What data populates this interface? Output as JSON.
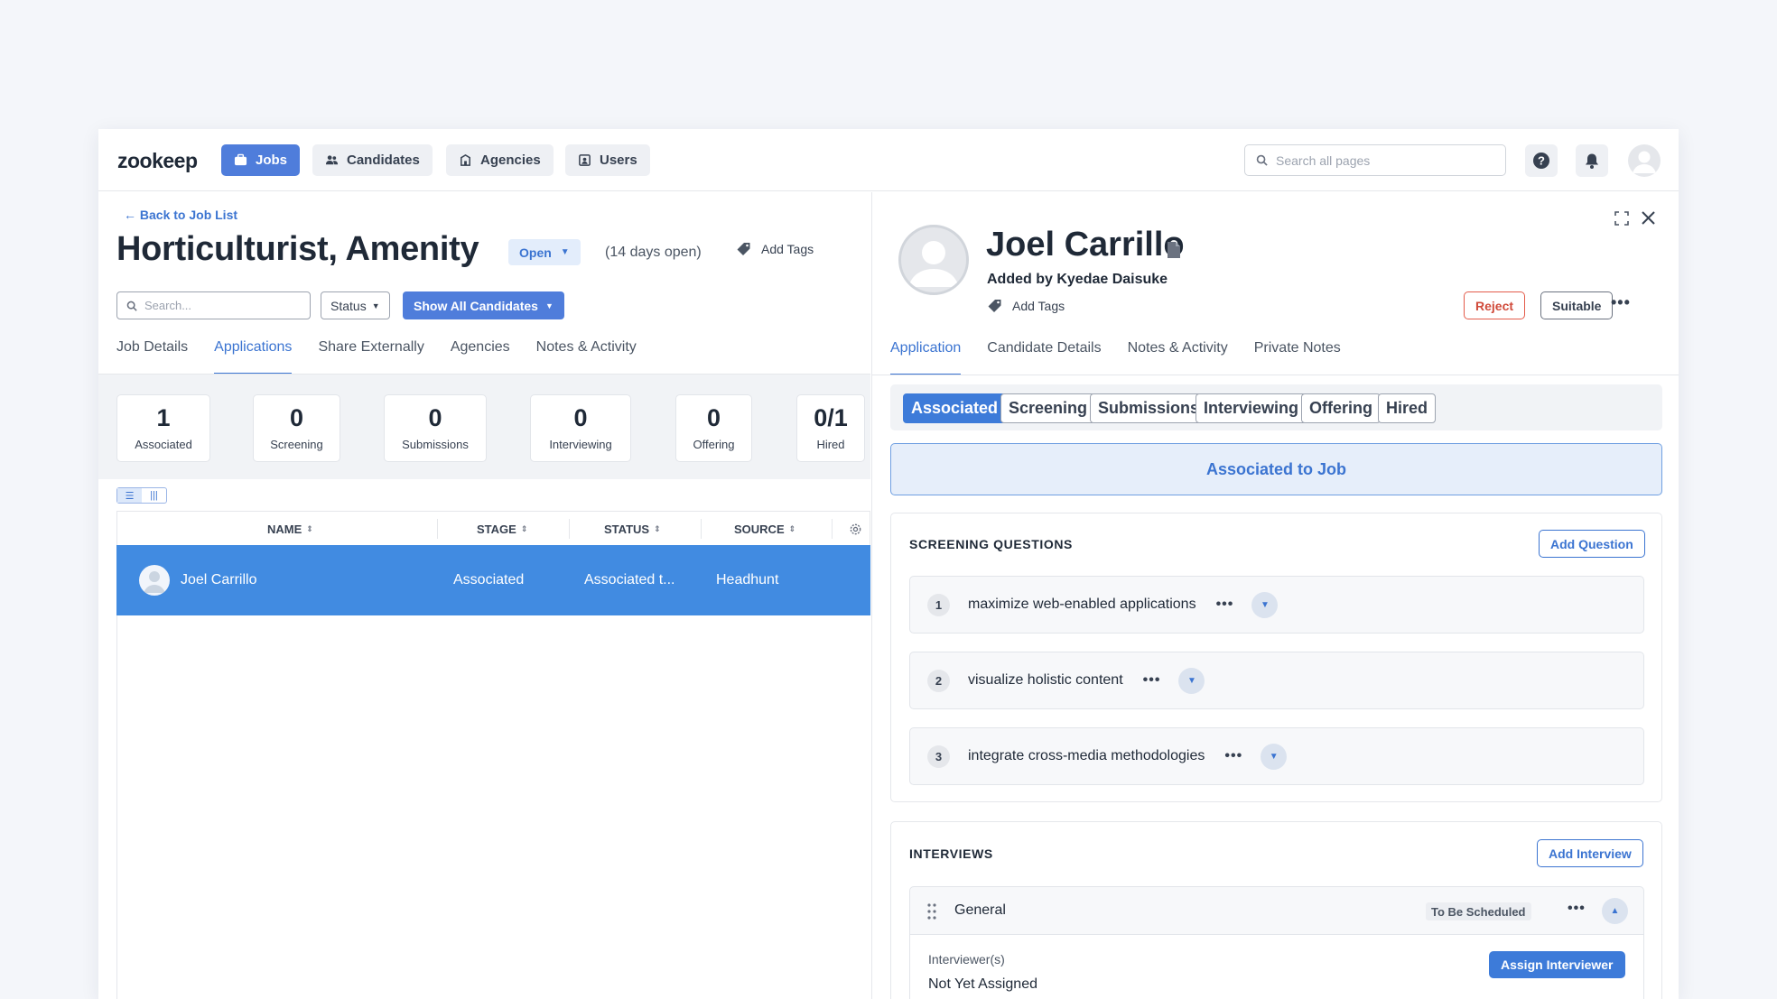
{
  "nav": {
    "logo": "zookeep",
    "items": [
      {
        "label": "Jobs",
        "icon": "briefcase-icon",
        "active": true
      },
      {
        "label": "Candidates",
        "icon": "users-icon",
        "active": false
      },
      {
        "label": "Agencies",
        "icon": "building-icon",
        "active": false
      },
      {
        "label": "Users",
        "icon": "user-badge-icon",
        "active": false
      }
    ],
    "search_placeholder": "Search all pages"
  },
  "job": {
    "back_link": "← Back to Job List",
    "title": "Horticulturist, Amenity",
    "status": "Open",
    "days_open": "(14 days open)",
    "add_tags": "Add Tags",
    "search_placeholder": "Search...",
    "status_filter": "Status",
    "show_all": "Show All Candidates",
    "tabs": [
      "Job Details",
      "Applications",
      "Share Externally",
      "Agencies",
      "Notes & Activity"
    ],
    "active_tab": "Applications",
    "stats": [
      {
        "value": "1",
        "label": "Associated"
      },
      {
        "value": "0",
        "label": "Screening"
      },
      {
        "value": "0",
        "label": "Submissions"
      },
      {
        "value": "0",
        "label": "Interviewing"
      },
      {
        "value": "0",
        "label": "Offering"
      },
      {
        "value": "0/1",
        "label": "Hired"
      }
    ],
    "table": {
      "columns": [
        "NAME",
        "STAGE",
        "STATUS",
        "SOURCE"
      ],
      "rows": [
        {
          "name": "Joel Carrillo",
          "stage": "Associated",
          "status": "Associated t...",
          "source": "Headhunt"
        }
      ]
    }
  },
  "candidate": {
    "name": "Joel Carrillo",
    "added_by": "Added by Kyedae Daisuke",
    "add_tags": "Add Tags",
    "reject": "Reject",
    "suitable": "Suitable",
    "tabs": [
      "Application",
      "Candidate Details",
      "Notes & Activity",
      "Private Notes"
    ],
    "active_tab": "Application",
    "stages": [
      "Associated",
      "Screening",
      "Submissions",
      "Interviewing",
      "Offering",
      "Hired"
    ],
    "active_stage": "Associated",
    "banner": "Associated to Job",
    "screening": {
      "title": "SCREENING QUESTIONS",
      "add_button": "Add Question",
      "questions": [
        {
          "num": "1",
          "text": "maximize web-enabled applications"
        },
        {
          "num": "2",
          "text": "visualize holistic content"
        },
        {
          "num": "3",
          "text": "integrate cross-media methodologies"
        }
      ]
    },
    "interviews": {
      "title": "INTERVIEWS",
      "add_button": "Add Interview",
      "item": {
        "name": "General",
        "status": "To Be Scheduled",
        "interviewer_label": "Interviewer(s)",
        "interviewer_value": "Not Yet Assigned",
        "assign_button": "Assign Interviewer"
      }
    }
  },
  "colors": {
    "accent": "#4f7ddb",
    "row_highlight": "#418be1",
    "reject": "#d04a3a"
  }
}
